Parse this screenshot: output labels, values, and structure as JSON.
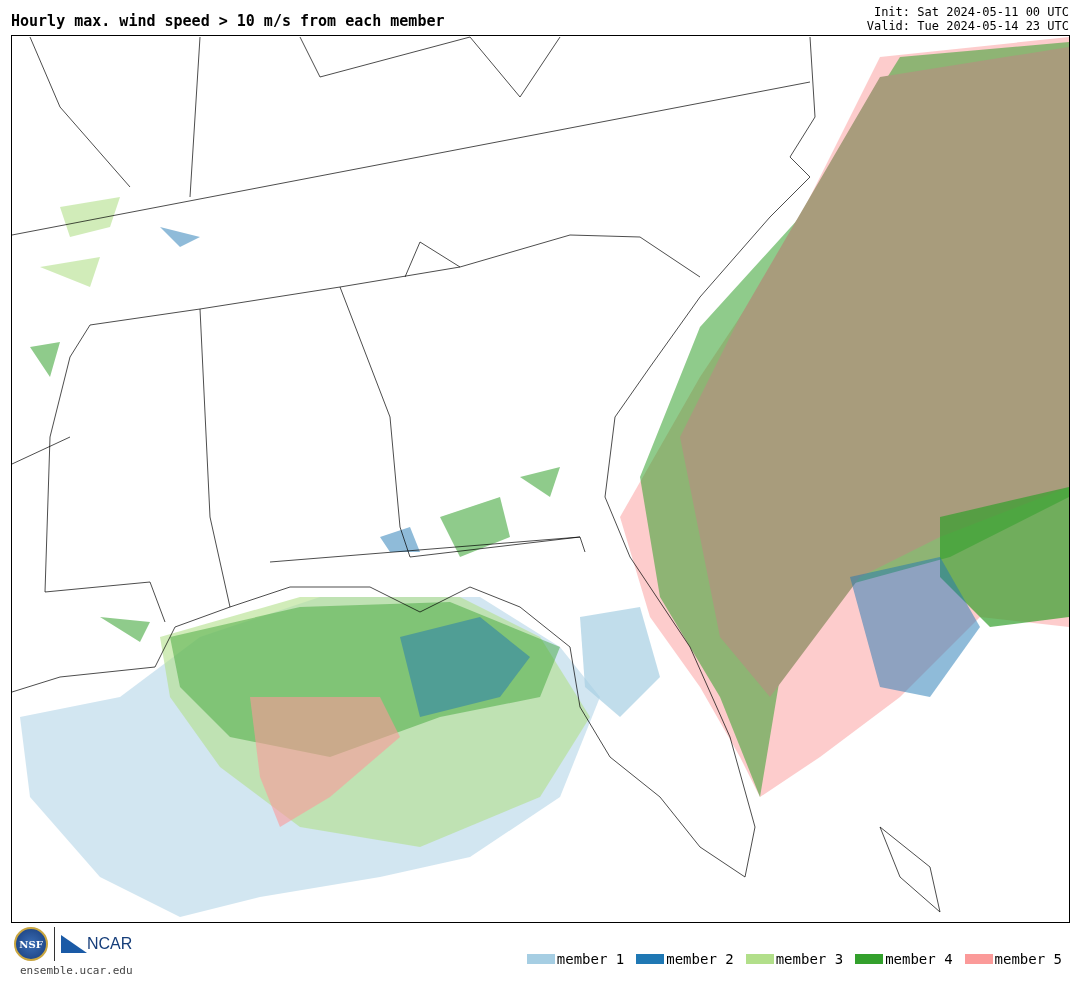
{
  "title": "Hourly max. wind speed > 10 m/s from each member",
  "init": "Init: Sat 2024-05-11 00 UTC",
  "valid": "Valid: Tue 2024-05-14 23 UTC",
  "logos": {
    "nsf": "NSF",
    "ncar": "NCAR"
  },
  "site": "ensemble.ucar.edu",
  "legend": [
    {
      "label": "member 1",
      "color": "#a6cee3"
    },
    {
      "label": "member 2",
      "color": "#1f78b4"
    },
    {
      "label": "member 3",
      "color": "#b2df8a"
    },
    {
      "label": "member 4",
      "color": "#33a02c"
    },
    {
      "label": "member 5",
      "color": "#fb9a99"
    }
  ]
}
